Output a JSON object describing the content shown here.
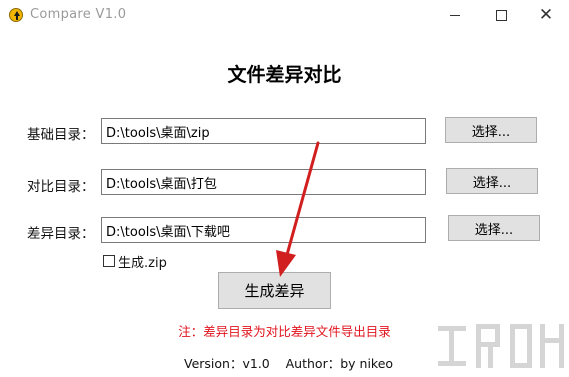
{
  "window": {
    "title": "Compare V1.0",
    "minimize_label": "minimize",
    "maximize_label": "maximize",
    "close_glyph": "✕"
  },
  "main": {
    "heading": "文件差异对比",
    "rows": [
      {
        "label": "基础目录：",
        "value": "D:\\tools\\桌面\\zip",
        "button": "选择..."
      },
      {
        "label": "对比目录：",
        "value": "D:\\tools\\桌面\\打包",
        "button": "选择..."
      },
      {
        "label": "差异目录：",
        "value": "D:\\tools\\桌面\\下载吧",
        "button": "选择..."
      }
    ],
    "zip_checkbox": {
      "label": "生成.zip",
      "checked": false
    },
    "generate_button": "生成差异",
    "note": "注：差异目录为对比差异文件导出目录",
    "footer": "Version：v1.0    Author：by nikeo"
  },
  "colors": {
    "note_red": "#e0141e",
    "annotation_arrow": "#d11f1f",
    "button_face": "#e1e1e1"
  },
  "icons": {
    "app": "up-arrow-circle-icon"
  }
}
